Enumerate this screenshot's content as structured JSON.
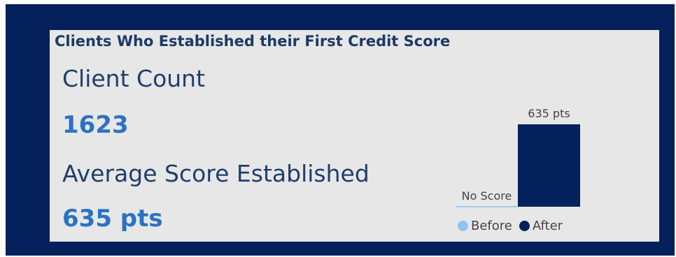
{
  "title": "Clients Who Established their First Credit Score",
  "kpis": [
    {
      "label": "Client Count",
      "value": "1623"
    },
    {
      "label": "Average Score Established",
      "value": "635 pts"
    }
  ],
  "colors": {
    "frame": "#04215c",
    "panel": "#e7e7e7",
    "value_text": "#2b72c4",
    "before": "#8ec3f0",
    "after": "#04215c"
  },
  "chart_data": {
    "type": "bar",
    "categories": [
      "Before",
      "After"
    ],
    "values": [
      0,
      635
    ],
    "data_labels": [
      "No Score",
      "635 pts"
    ],
    "ylim": [
      0,
      635
    ],
    "legend": [
      {
        "name": "Before",
        "color": "#8ec3f0"
      },
      {
        "name": "After",
        "color": "#04215c"
      }
    ],
    "legend_position": "bottom"
  }
}
